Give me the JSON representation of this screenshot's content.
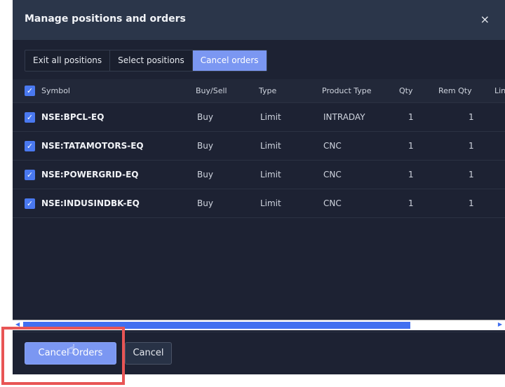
{
  "dialog": {
    "title": "Manage positions and orders",
    "close_icon": "×"
  },
  "segments": [
    "Exit all positions",
    "Select positions",
    "Cancel orders"
  ],
  "active_segment": 2,
  "table": {
    "columns": [
      "Symbol",
      "Buy/Sell",
      "Type",
      "Product Type",
      "Qty",
      "Rem Qty",
      "Lin"
    ],
    "rows": [
      {
        "symbol": "NSE:BPCL-EQ",
        "side": "Buy",
        "type": "Limit",
        "product": "INTRADAY",
        "qty": "1",
        "rem": "1"
      },
      {
        "symbol": "NSE:TATAMOTORS-EQ",
        "side": "Buy",
        "type": "Limit",
        "product": "CNC",
        "qty": "1",
        "rem": "1"
      },
      {
        "symbol": "NSE:POWERGRID-EQ",
        "side": "Buy",
        "type": "Limit",
        "product": "CNC",
        "qty": "1",
        "rem": "1"
      },
      {
        "symbol": "NSE:INDUSINDBK-EQ",
        "side": "Buy",
        "type": "Limit",
        "product": "CNC",
        "qty": "1",
        "rem": "1"
      }
    ]
  },
  "scroll": {
    "thumb_fraction": 0.8
  },
  "footer": {
    "confirm": "Cancel Orders",
    "cancel": "Cancel"
  },
  "colors": {
    "accent": "#7b97f2",
    "highlight": "#e85555"
  }
}
